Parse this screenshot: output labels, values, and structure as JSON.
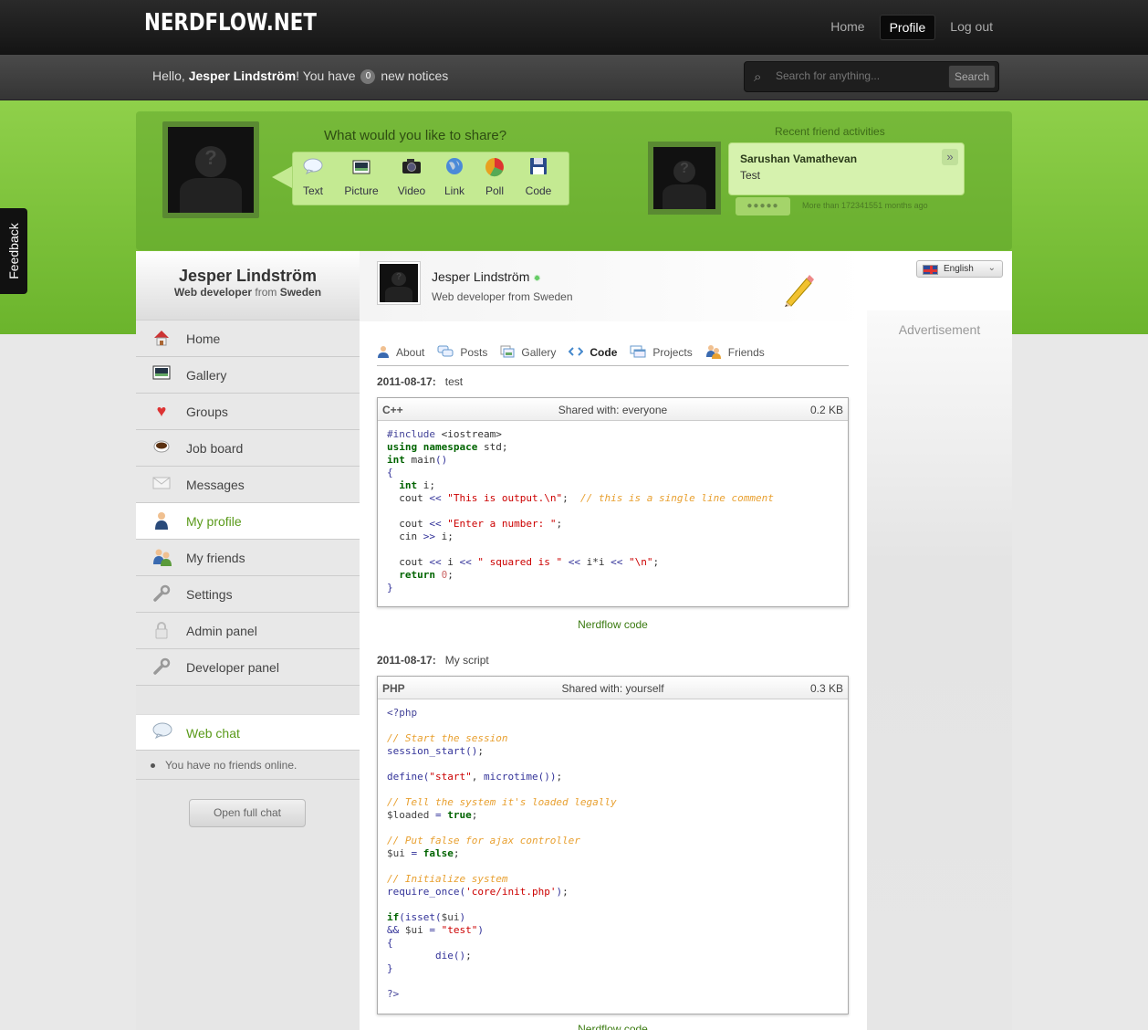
{
  "brand": "NERDFLOW.NET",
  "topnav": [
    {
      "label": "Home"
    },
    {
      "label": "Profile"
    },
    {
      "label": "Log out"
    }
  ],
  "greeting": {
    "prefix": "Hello, ",
    "user": "Jesper Lindström",
    "middle": "! You have ",
    "count": "0",
    "suffix": " new notices"
  },
  "search": {
    "placeholder": "Search for anything...",
    "button": "Search"
  },
  "share": {
    "title": "What would you like to share?",
    "items": [
      {
        "label": "Text",
        "icon": "speech-bubble-icon"
      },
      {
        "label": "Picture",
        "icon": "picture-icon"
      },
      {
        "label": "Video",
        "icon": "camera-icon"
      },
      {
        "label": "Link",
        "icon": "globe-icon"
      },
      {
        "label": "Poll",
        "icon": "pie-chart-icon"
      },
      {
        "label": "Code",
        "icon": "floppy-disk-icon"
      }
    ]
  },
  "recent": {
    "title": "Recent friend activities",
    "name": "Sarushan Vamathevan",
    "text": "Test",
    "dots": "●●●●●",
    "time": "More than 172341551 months ago"
  },
  "feedback": "Feedback",
  "sidebar": {
    "name": "Jesper Lindström",
    "role": "Web developer",
    "from": " from ",
    "country": "Sweden",
    "items": [
      {
        "label": "Home",
        "icon": "house-icon"
      },
      {
        "label": "Gallery",
        "icon": "picture-icon"
      },
      {
        "label": "Groups",
        "icon": "heart-icon"
      },
      {
        "label": "Job board",
        "icon": "coffee-cup-icon"
      },
      {
        "label": "Messages",
        "icon": "envelope-icon"
      },
      {
        "label": "My profile",
        "icon": "user-icon"
      },
      {
        "label": "My friends",
        "icon": "users-icon"
      },
      {
        "label": "Settings",
        "icon": "wrench-icon"
      },
      {
        "label": "Admin panel",
        "icon": "lock-icon"
      },
      {
        "label": "Developer panel",
        "icon": "wrench-icon"
      }
    ],
    "chat_label": "Web chat",
    "offline_text": "You have no friends online.",
    "open_chat": "Open full chat"
  },
  "profile": {
    "name": "Jesper Lindström",
    "subtitle": "Web developer from Sweden"
  },
  "tabs": [
    {
      "label": "About",
      "icon": "user-icon"
    },
    {
      "label": "Posts",
      "icon": "speech-bubbles-icon"
    },
    {
      "label": "Gallery",
      "icon": "gallery-icon"
    },
    {
      "label": "Code",
      "icon": "code-icon"
    },
    {
      "label": "Projects",
      "icon": "windows-icon"
    },
    {
      "label": "Friends",
      "icon": "users-icon"
    }
  ],
  "posts": [
    {
      "date": "2011-08-17:",
      "title": "test",
      "lang": "C++",
      "shared": "Shared with: everyone",
      "size": "0.2 KB",
      "footer": "Nerdflow code"
    },
    {
      "date": "2011-08-17:",
      "title": "My script",
      "lang": "PHP",
      "shared": "Shared with: yourself",
      "size": "0.3 KB",
      "footer": "Nerdflow code"
    }
  ],
  "language": "English",
  "advertisement": "Advertisement"
}
